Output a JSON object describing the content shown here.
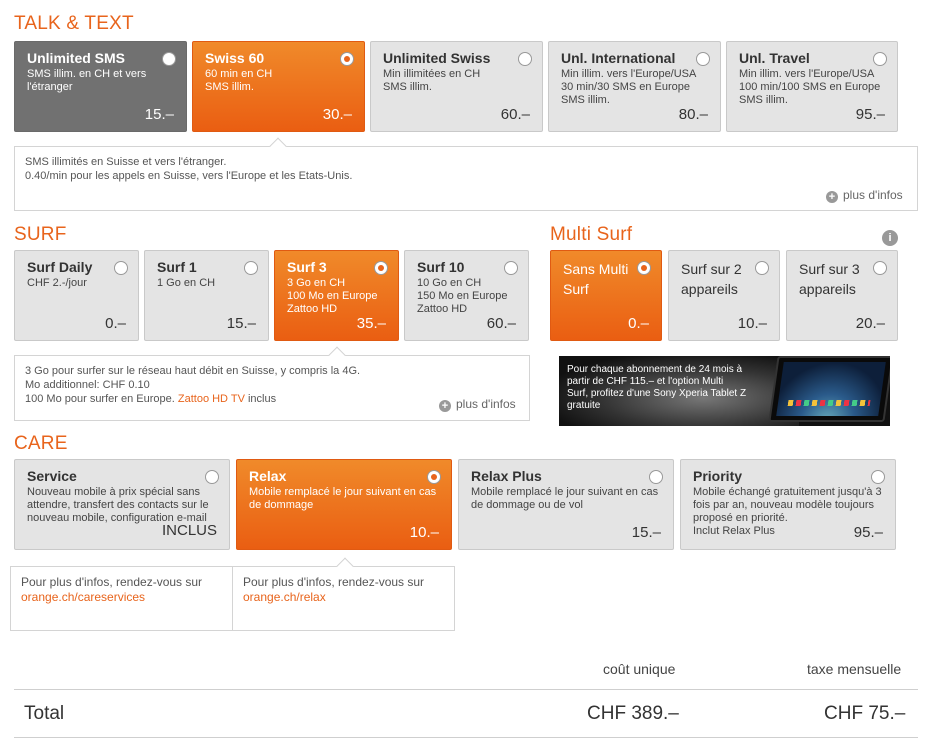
{
  "talk": {
    "title": "TALK & TEXT",
    "cards": [
      {
        "title": "Unlimited SMS",
        "desc": "SMS illim. en CH et vers l'étranger",
        "price": "15.–"
      },
      {
        "title": "Swiss 60",
        "desc": "60 min en CH\nSMS illim.",
        "price": "30.–"
      },
      {
        "title": "Unlimited Swiss",
        "desc": "Min illimitées en CH\nSMS illim.",
        "price": "60.–"
      },
      {
        "title": "Unl. International",
        "desc": "Min illim. vers l'Europe/USA\n30 min/30 SMS en Europe\nSMS illim.",
        "price": "80.–"
      },
      {
        "title": "Unl. Travel",
        "desc": "Min illim. vers l'Europe/USA\n100 min/100 SMS en Europe\nSMS illim.",
        "price": "95.–"
      }
    ],
    "info_line1": "SMS illimités en Suisse et vers l'étranger.",
    "info_line2": "0.40/min pour les appels en Suisse, vers l'Europe et les Etats-Unis.",
    "more": "plus d'infos"
  },
  "surf": {
    "title": "SURF",
    "cards": [
      {
        "title": "Surf Daily",
        "desc": "CHF 2.-/jour",
        "price": "0.–"
      },
      {
        "title": "Surf 1",
        "desc": "1 Go en CH",
        "price": "15.–"
      },
      {
        "title": "Surf 3",
        "desc": "3 Go en CH\n100 Mo en Europe\nZattoo HD",
        "price": "35.–"
      },
      {
        "title": "Surf 10",
        "desc": "10 Go en CH\n150 Mo en Europe\nZattoo HD",
        "price": "60.–"
      }
    ],
    "info_line1": "3 Go pour surfer sur le réseau haut débit en Suisse, y compris la 4G.",
    "info_line2": "Mo additionnel: CHF 0.10",
    "info_line3_pre": "100 Mo pour surfer en Europe. ",
    "info_link": "Zattoo HD TV",
    "info_line3_post": " inclus",
    "more": "plus d'infos"
  },
  "multisurf": {
    "title": "Multi Surf",
    "info_icon": "i",
    "cards": [
      {
        "title": "Sans Multi Surf",
        "price": "0.–"
      },
      {
        "title": "Surf sur 2 appareils",
        "price": "10.–"
      },
      {
        "title": "Surf sur 3 appareils",
        "price": "20.–"
      }
    ],
    "promo": "Pour chaque abonnement de 24 mois à partir de CHF 115.– et l'option Multi Surf, profitez d'une Sony Xperia Tablet Z gratuite"
  },
  "care": {
    "title": "CARE",
    "cards": [
      {
        "title": "Service",
        "desc": "Nouveau mobile à prix spécial sans attendre, transfert des contacts sur le nouveau mobile, configuration e-mail",
        "price": "INCLUS"
      },
      {
        "title": "Relax",
        "desc": "Mobile remplacé le jour suivant en cas de dommage",
        "price": "10.–"
      },
      {
        "title": "Relax Plus",
        "desc": "Mobile remplacé le jour suivant en cas de dommage ou de vol",
        "price": "15.–"
      },
      {
        "title": "Priority",
        "desc": "Mobile échangé gratuitement jusqu'à 3 fois par an, nouveau modèle toujours proposé en priorité.\nInclut Relax Plus",
        "price": "95.–"
      }
    ],
    "info1_text": "Pour plus d'infos, rendez-vous sur",
    "info1_link": "orange.ch/careservices",
    "info2_text": "Pour plus d'infos, rendez-vous sur",
    "info2_link": "orange.ch/relax"
  },
  "summary": {
    "col_once": "coût unique",
    "col_monthly": "taxe mensuelle",
    "total_label": "Total",
    "total_once": "CHF 389.–",
    "total_monthly": "CHF 75.–"
  },
  "colors": {
    "accent": "#e8641c",
    "selected_dark": "#717171",
    "card_bg": "#e4e4e4"
  }
}
